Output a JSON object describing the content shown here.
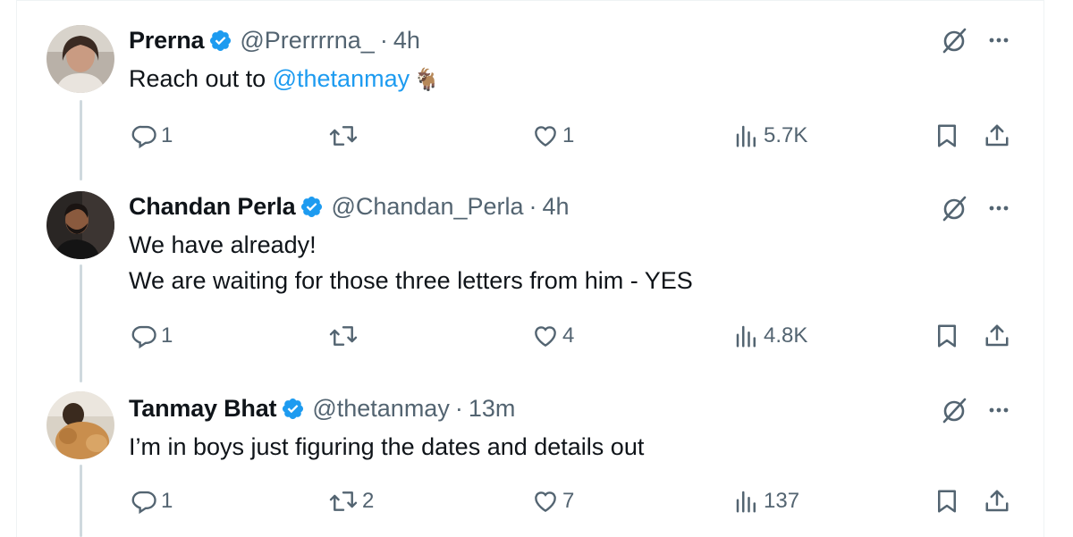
{
  "tweets": [
    {
      "name": "Prerna",
      "handle": "@Prerrrrna_",
      "separator": "·",
      "time": "4h",
      "text_plain": "Reach out to ",
      "text_mention": "@thetanmay",
      "text_emoji": "🐐",
      "replies": "1",
      "reposts": "",
      "likes": "1",
      "views": "5.7K"
    },
    {
      "name": "Chandan Perla",
      "handle": "@Chandan_Perla",
      "separator": "·",
      "time": "4h",
      "text_line1": "We have already!",
      "text_line2": "We are waiting for those three letters from him - YES",
      "replies": "1",
      "reposts": "",
      "likes": "4",
      "views": "4.8K"
    },
    {
      "name": "Tanmay Bhat",
      "handle": "@thetanmay",
      "separator": "·",
      "time": "13m",
      "text_line1": "I’m in boys just figuring the dates and details out",
      "replies": "1",
      "reposts": "2",
      "likes": "7",
      "views": "137"
    }
  ],
  "icons": {
    "verified": "verified-badge-icon",
    "grok": "grok-icon",
    "more": "more-options-icon",
    "reply": "reply-icon",
    "repost": "repost-icon",
    "like": "like-icon",
    "views": "views-icon",
    "bookmark": "bookmark-icon",
    "share": "share-icon"
  },
  "colors": {
    "text": "#0f1419",
    "secondary": "#536471",
    "accent": "#1d9bf0",
    "thread_line": "#cfd9de"
  }
}
